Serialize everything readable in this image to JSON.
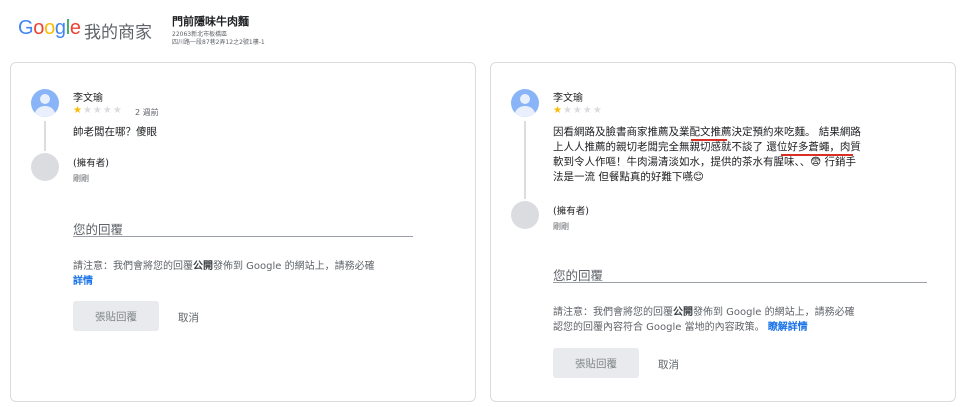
{
  "header": {
    "logo": {
      "g1": "G",
      "o1": "o",
      "o2": "o",
      "g2": "g",
      "l": "l",
      "e": "e"
    },
    "product": "我的商家",
    "business_name": "門前隱味牛肉麵",
    "address_line1": "22063新北市板橋區",
    "address_line2": "四川路一段87巷2弄12之2號1樓-1"
  },
  "review_left": {
    "reviewer_name": "李文瑜",
    "stars_filled": "★",
    "stars_empty": "★★★★",
    "rating": 1,
    "time": "2 週前",
    "text": "帥老闆在哪？傻眼",
    "owner_label": "(擁有者)",
    "owner_time": "剛剛",
    "reply_placeholder": "您的回覆",
    "notice_prefix": "請注意：我們會將您的回覆",
    "notice_bold": "公開",
    "notice_suffix": "發佈到 Google 的網站上，請務必確",
    "notice_link": "詳情",
    "submit_label": "張貼回覆",
    "cancel_label": "取消"
  },
  "review_right": {
    "reviewer_name": "李文瑜",
    "stars_filled": "★",
    "stars_empty": "★★★★",
    "rating": 1,
    "text_line1": "因看網路及臉書商家推薦及業配文推薦決定預約來吃麵。 結果網路",
    "text_line2": "上人人推薦的親切老闆完全無親切感就不談了 還位好多蒼蠅，肉質",
    "text_line3": "軟到令人作嘔！牛肉湯清淡如水，提供的茶水有腥味、、😨 行銷手",
    "text_line4": "法是一流 但餐點真的好難下嚥😊",
    "owner_label": "(擁有者)",
    "owner_time": "剛剛",
    "reply_placeholder": "您的回覆",
    "notice_prefix": "請注意：我們會將您的回覆",
    "notice_bold": "公開",
    "notice_suffix": "發佈到 Google 的網站上，請務必確",
    "notice_line2": "認您的回覆內容符合 Google 當地的內容政策。",
    "notice_link": "瞭解詳情",
    "submit_label": "張貼回覆",
    "cancel_label": "取消"
  }
}
